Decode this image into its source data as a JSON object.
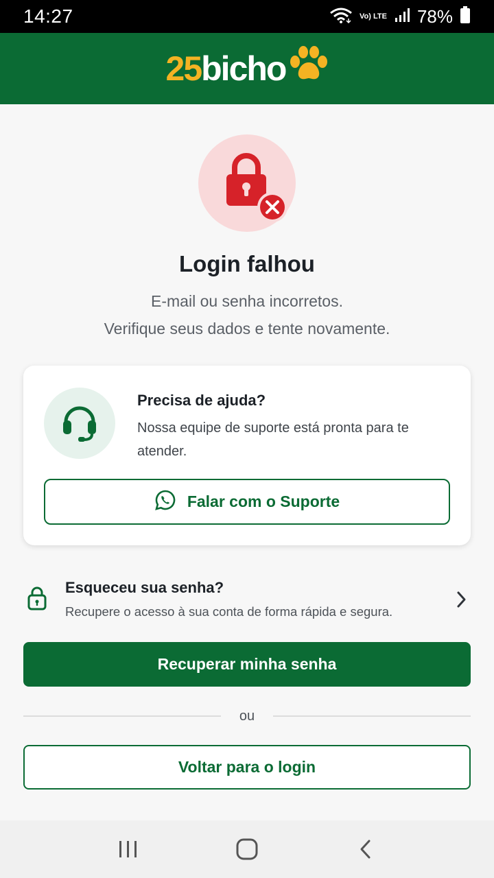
{
  "status_bar": {
    "time": "14:27",
    "network_label": "Vo) LTE",
    "battery": "78%"
  },
  "app": {
    "logo_number": "25",
    "logo_word": "bicho",
    "logo_icon": "paw-icon",
    "brand_green": "#0b6b34",
    "brand_yellow": "#f4b323"
  },
  "error": {
    "icon": "lock-error-icon",
    "title": "Login falhou",
    "line1": "E-mail ou senha incorretos.",
    "line2": "Verifique seus dados e tente novamente."
  },
  "help_card": {
    "icon": "headset-icon",
    "title": "Precisa de ajuda?",
    "text": "Nossa equipe de suporte está pronta para te atender.",
    "button_icon": "whatsapp-icon",
    "button_label": "Falar com o Suporte"
  },
  "forgot": {
    "icon": "lock-icon",
    "title": "Esqueceu sua senha?",
    "text": "Recupere o acesso à sua conta de forma rápida e segura."
  },
  "buttons": {
    "recover_label": "Recuperar minha senha",
    "divider_text": "ou",
    "back_label": "Voltar para o login"
  },
  "nav_bar": {
    "recents": "recents-icon",
    "home": "home-icon",
    "back": "back-icon"
  }
}
